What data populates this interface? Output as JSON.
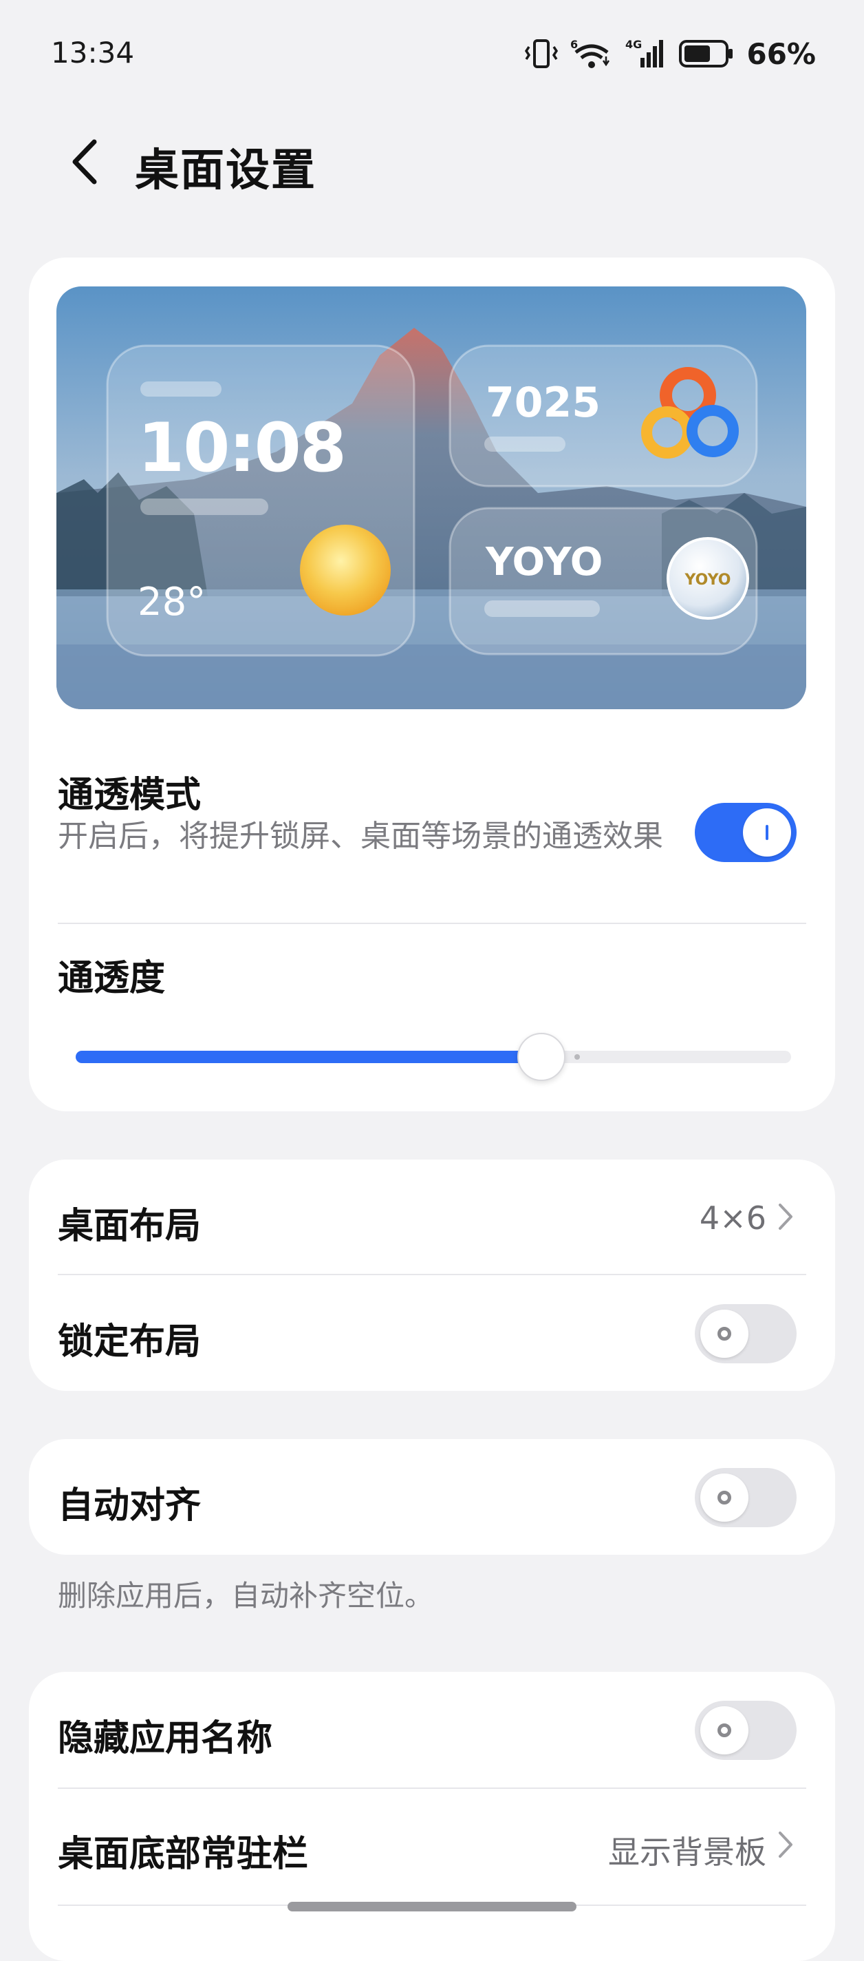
{
  "status_bar": {
    "time": "13:34",
    "network_label": "4G",
    "wifi_label": "6",
    "battery_percent": "66%",
    "battery_level": 0.66
  },
  "header": {
    "title": "桌面设置",
    "back_icon": "chevron-left-icon"
  },
  "preview": {
    "clock": "10:08",
    "temperature": "28°",
    "steps": "7025",
    "yoyo_label": "YOYO",
    "yoyo_badge": "YOYO"
  },
  "transparency": {
    "title": "通透模式",
    "description": "开启后，将提升锁屏、桌面等场景的通透效果",
    "enabled": true,
    "level_title": "通透度",
    "level": 0.68
  },
  "layout_group": {
    "layout_title": "桌面布局",
    "layout_value": "4×6",
    "lock_title": "锁定布局",
    "lock_enabled": false
  },
  "align_group": {
    "title": "自动对齐",
    "enabled": false,
    "note": "删除应用后，自动补齐空位。"
  },
  "names_group": {
    "hide_names_title": "隐藏应用名称",
    "hide_names_enabled": false,
    "dock_title": "桌面底部常驻栏",
    "dock_value": "显示背景板"
  },
  "colors": {
    "accent": "#2d6cf6",
    "page_bg": "#f2f2f4"
  }
}
